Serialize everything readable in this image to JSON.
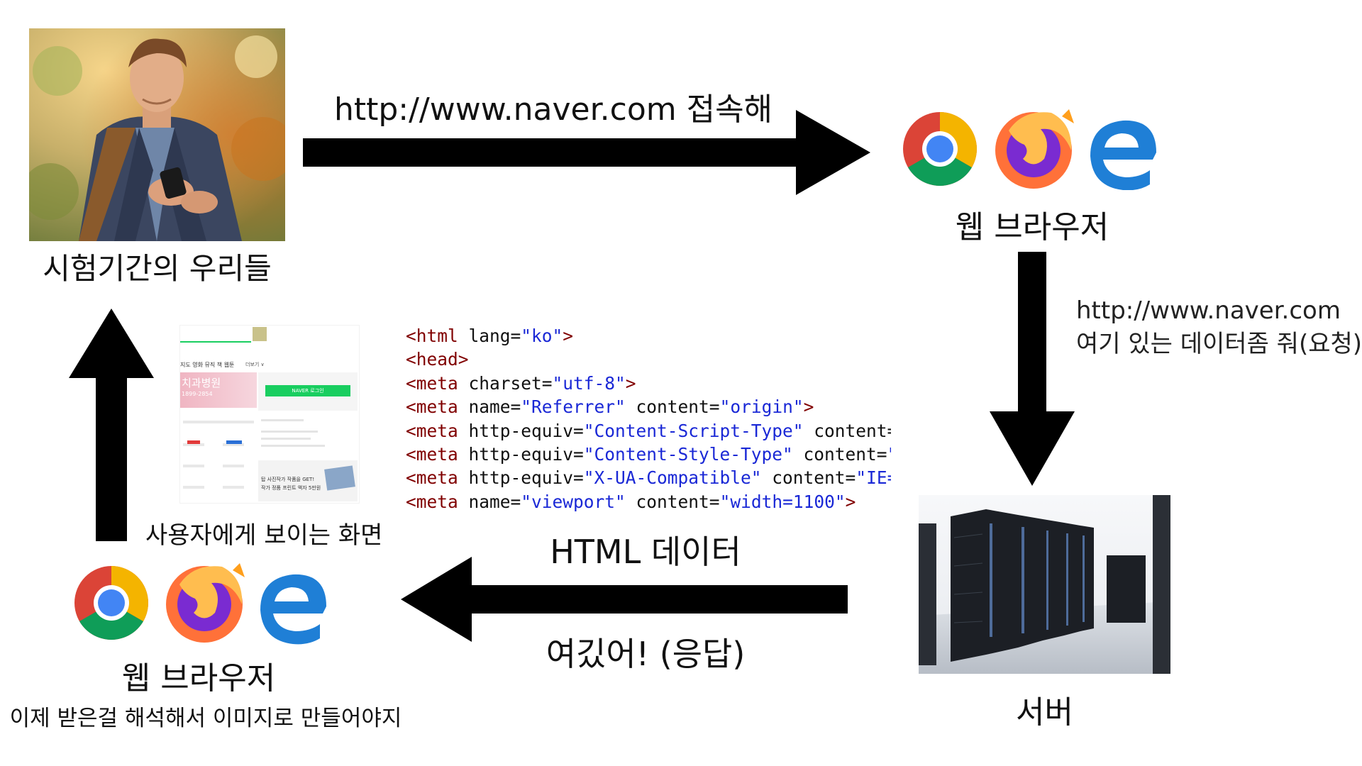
{
  "user": {
    "label": "시험기간의 우리들"
  },
  "browser_top": {
    "label": "웹 브라우저",
    "icons": [
      "chrome-icon",
      "firefox-icon",
      "edge-icon"
    ]
  },
  "request_arrow": {
    "label": "http://www.naver.com 접속해"
  },
  "server_request": {
    "line1": "http://www.naver.com",
    "line2": "여기 있는 데이터좀 줘(요청)"
  },
  "server": {
    "label": "서버"
  },
  "response_arrow": {
    "label_top": "HTML 데이터",
    "label_bottom": "여깄어! (응답)"
  },
  "browser_bottom": {
    "label": "웹 브라우저",
    "sublabel": "이제 받은걸 해석해서 이미지로 만들어야지",
    "icons": [
      "chrome-icon",
      "firefox-icon",
      "edge-icon"
    ]
  },
  "user_screen": {
    "label": "사용자에게 보이는 화면",
    "thumb": {
      "menu": "지도  영화  뮤직  책  웹툰",
      "more": "더보기 ∨",
      "ad": "치과병원",
      "ad_phone": "1899-2854",
      "login": "NAVER 로그인",
      "banner_line1": "탑 사진작가 작품을 GET!",
      "banner_line2": "작가 정품 프린트 액자 5만원"
    }
  },
  "code": {
    "lines": [
      {
        "tag": "<html",
        "parts": [
          {
            "a": " lang="
          },
          {
            "v": "\"ko\""
          }
        ],
        "end": ">"
      },
      {
        "tag": "<head>",
        "parts": [],
        "end": ""
      },
      {
        "tag": "<meta",
        "parts": [
          {
            "a": " charset="
          },
          {
            "v": "\"utf-8\""
          }
        ],
        "end": ">"
      },
      {
        "tag": "<meta",
        "parts": [
          {
            "a": " name="
          },
          {
            "v": "\"Referrer\""
          },
          {
            "a": " content="
          },
          {
            "v": "\"origin\""
          }
        ],
        "end": ">"
      },
      {
        "tag": "<meta",
        "parts": [
          {
            "a": " http-equiv="
          },
          {
            "v": "\"Content-Script-Type\""
          },
          {
            "a": " content="
          },
          {
            "v": "\"t"
          }
        ],
        "end": ""
      },
      {
        "tag": "<meta",
        "parts": [
          {
            "a": " http-equiv="
          },
          {
            "v": "\"Content-Style-Type\""
          },
          {
            "a": " content="
          },
          {
            "v": "\"te"
          }
        ],
        "end": ""
      },
      {
        "tag": "<meta",
        "parts": [
          {
            "a": " http-equiv="
          },
          {
            "v": "\"X-UA-Compatible\""
          },
          {
            "a": " content="
          },
          {
            "v": "\"IE=ed"
          }
        ],
        "end": ""
      },
      {
        "tag": "<meta",
        "parts": [
          {
            "a": " name="
          },
          {
            "v": "\"viewport\""
          },
          {
            "a": " content="
          },
          {
            "v": "\"width=1100\""
          }
        ],
        "end": ">"
      }
    ]
  },
  "colors": {
    "arrow": "#000000",
    "code_tag": "#800000",
    "code_value": "#1a28d6",
    "naver_green": "#19ce60"
  }
}
